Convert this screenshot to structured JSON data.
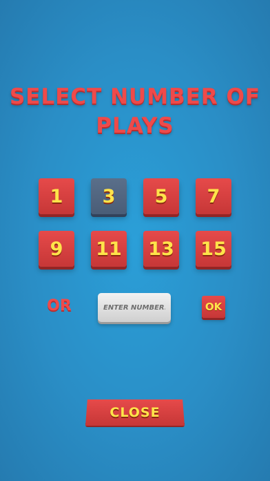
{
  "title": {
    "line1": "SELECT NUMBER OF",
    "line2": "PLAYS"
  },
  "play_options": [
    "1",
    "3",
    "5",
    "7",
    "9",
    "11",
    "13",
    "15"
  ],
  "selected_option": "3",
  "or_label": "OR",
  "custom_input": {
    "placeholder": "ENTER NUMBER...",
    "value": ""
  },
  "ok_label": "OK",
  "close_label": "CLOSE",
  "colors": {
    "background": "#2b9fd8",
    "button_red": "#e64a4a",
    "button_selected": "#5a6f8a",
    "label_yellow": "#ffe44a",
    "title_red": "#ef4a4a"
  }
}
